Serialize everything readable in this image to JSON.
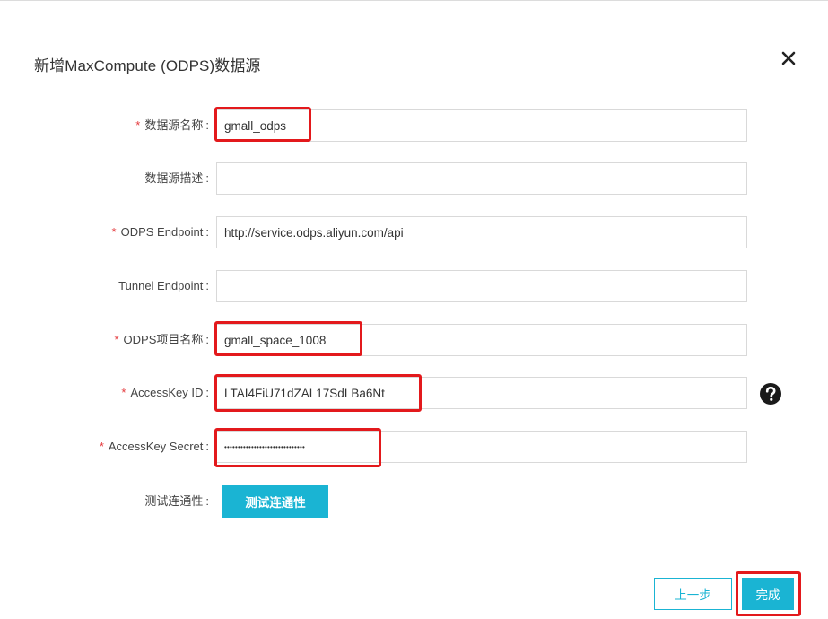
{
  "dialog": {
    "title": "新增MaxCompute (ODPS)数据源",
    "close_icon": "close-icon"
  },
  "form": {
    "required_mark": "*",
    "colon": ":",
    "fields": [
      {
        "label": "数据源名称",
        "required": true,
        "value": "gmall_odps",
        "placeholder": ""
      },
      {
        "label": "数据源描述",
        "required": false,
        "value": "",
        "placeholder": ""
      },
      {
        "label": "ODPS Endpoint",
        "required": true,
        "value": "http://service.odps.aliyun.com/api",
        "placeholder": ""
      },
      {
        "label": "Tunnel Endpoint",
        "required": false,
        "value": "",
        "placeholder": ""
      },
      {
        "label": "ODPS项目名称",
        "required": true,
        "value": "gmall_space_1008",
        "placeholder": ""
      },
      {
        "label": "AccessKey ID",
        "required": true,
        "value": "LTAI4FiU71dZAL17SdLBa6Nt",
        "placeholder": ""
      },
      {
        "label": "AccessKey Secret",
        "required": true,
        "value": "••••••••••••••••••••••••••••••",
        "placeholder": ""
      }
    ],
    "help_icon": "question-circle-icon",
    "connectivity": {
      "label": "测试连通性",
      "button": "测试连通性"
    }
  },
  "footer": {
    "prev_label": "上一步",
    "done_label": "完成"
  },
  "colors": {
    "accent": "#1ab4d3",
    "highlight": "#e3191c",
    "required": "#e4393c"
  }
}
